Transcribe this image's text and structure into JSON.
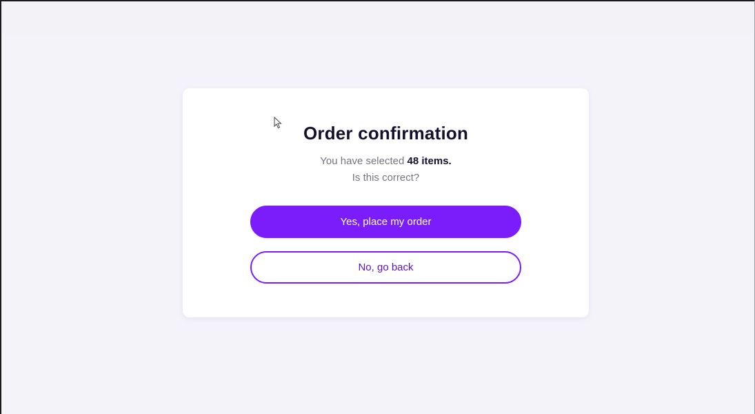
{
  "dialog": {
    "title": "Order confirmation",
    "message_prefix": "You have selected ",
    "item_count": "48 items.",
    "question": "Is this correct?",
    "confirm_label": "Yes, place my order",
    "cancel_label": "No, go back"
  },
  "colors": {
    "accent": "#7b1dfb",
    "title_text": "#16102f",
    "muted_text": "#75737e",
    "page_background": "#f5f3fa"
  },
  "icons": {
    "cursor": "mouse-pointer-icon"
  }
}
